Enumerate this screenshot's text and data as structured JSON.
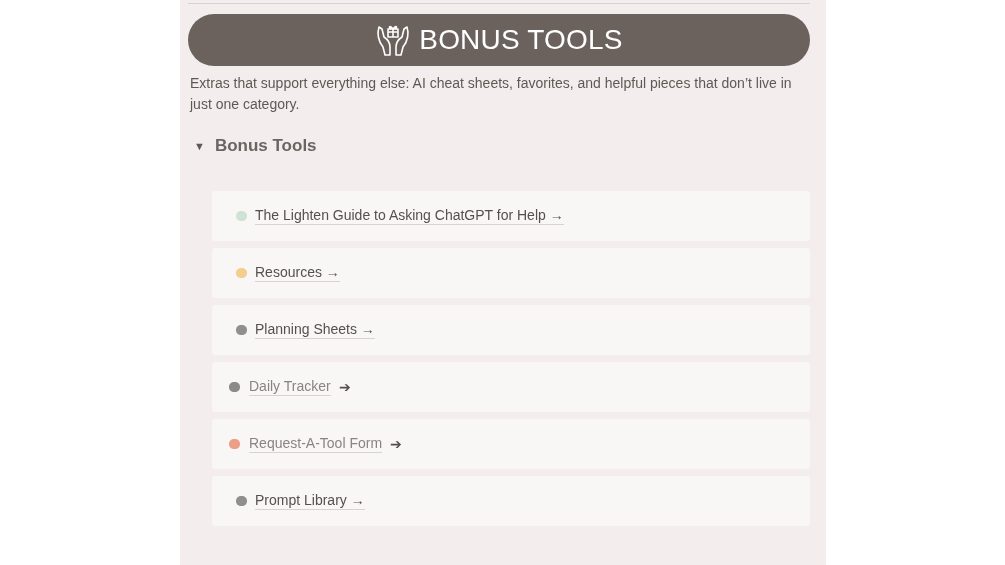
{
  "banner": {
    "title": "BONUS TOOLS"
  },
  "description": "Extras that support everything else: AI cheat sheets, favorites, and helpful pieces that don’t live in just one category.",
  "toggle": {
    "label": "Bonus Tools",
    "expanded": true,
    "marker": "▼"
  },
  "items": [
    {
      "kind": "link",
      "label": "The Lighten Guide to Asking ChatGPT for Help →",
      "color": "#cfe3d4"
    },
    {
      "kind": "link",
      "label": "Resources →",
      "color": "#f2cf8e"
    },
    {
      "kind": "link",
      "label": "Planning Sheets →",
      "color": "#8f8f8f"
    },
    {
      "kind": "split",
      "label": "Daily Tracker",
      "suffix": "➔",
      "color": "#8a8a8a"
    },
    {
      "kind": "split",
      "label": "Request-A-Tool Form",
      "suffix": "➔",
      "color": "#ec9e86"
    },
    {
      "kind": "link",
      "label": "Prompt Library →",
      "color": "#8f8f8f"
    }
  ]
}
